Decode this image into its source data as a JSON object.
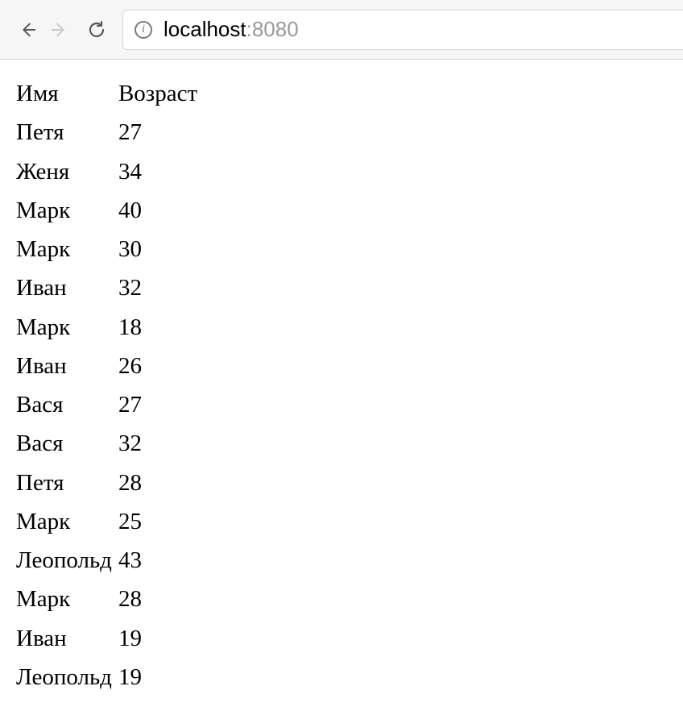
{
  "browser": {
    "url_host": "localhost",
    "url_port": ":8080"
  },
  "table": {
    "headers": {
      "name": "Имя",
      "age": "Возраст"
    },
    "rows": [
      {
        "name": "Петя",
        "age": "27"
      },
      {
        "name": "Женя",
        "age": "34"
      },
      {
        "name": "Марк",
        "age": "40"
      },
      {
        "name": "Марк",
        "age": "30"
      },
      {
        "name": "Иван",
        "age": "32"
      },
      {
        "name": "Марк",
        "age": "18"
      },
      {
        "name": "Иван",
        "age": "26"
      },
      {
        "name": "Вася",
        "age": "27"
      },
      {
        "name": "Вася",
        "age": "32"
      },
      {
        "name": "Петя",
        "age": "28"
      },
      {
        "name": "Марк",
        "age": "25"
      },
      {
        "name": "Леопольд",
        "age": "43"
      },
      {
        "name": "Марк",
        "age": "28"
      },
      {
        "name": "Иван",
        "age": "19"
      },
      {
        "name": "Леопольд",
        "age": "19"
      }
    ]
  }
}
